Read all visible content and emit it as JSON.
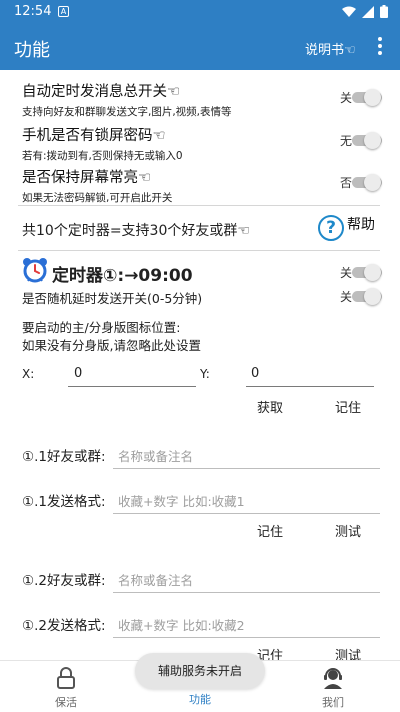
{
  "status_bar": {
    "time": "12:54",
    "notif_icon": "A"
  },
  "app_bar": {
    "title": "功能",
    "manual": "说明书☜"
  },
  "settings": [
    {
      "title": "自动定时发消息总开关☜",
      "subtitle": "支持向好友和群聊发送文字,图片,视频,表情等",
      "toggle": "关"
    },
    {
      "title": "手机是否有锁屏密码☜",
      "subtitle": "若有:拨动到有,否则保持无或输入0",
      "toggle": "无"
    },
    {
      "title": "是否保持屏幕常亮☜",
      "subtitle": "如果无法密码解锁,可开启此开关",
      "toggle": "否"
    }
  ],
  "timers_banner": {
    "text": "共10个定时器=支持30个好友或群☜",
    "help": "帮助",
    "help_icon": "?"
  },
  "timer": {
    "title": "定时器①:→09:00",
    "toggle": "关",
    "random_delay": "是否随机延时发送开关(0-5分钟)",
    "random_toggle": "关",
    "icon_hint_1": "要启动的主/分身版图标位置:",
    "icon_hint_2": "如果没有分身版,请忽略此处设置",
    "x_label": "X:",
    "x_value": "0",
    "y_label": "Y:",
    "y_value": "0",
    "get_button": "获取",
    "remember_button": "记住"
  },
  "entries": [
    {
      "friend_label": "①.1好友或群:",
      "friend_placeholder": "名称或备注名",
      "format_label": "①.1发送格式:",
      "format_placeholder": "收藏+数字 比如:收藏1",
      "remember": "记住",
      "test": "测试"
    },
    {
      "friend_label": "①.2好友或群:",
      "friend_placeholder": "名称或备注名",
      "format_label": "①.2发送格式:",
      "format_placeholder": "收藏+数字 比如:收藏2",
      "remember": "记住",
      "test": "测试"
    }
  ],
  "toast": "辅助服务未开启",
  "bottom_nav": [
    {
      "label": "保活",
      "icon": "lock-icon"
    },
    {
      "label": "功能",
      "icon": "function-icon"
    },
    {
      "label": "我们",
      "icon": "support-agent-icon"
    }
  ],
  "colors": {
    "primary": "#2e7fc4",
    "help": "#1e88c9",
    "alarm": "#2a6fd6"
  }
}
